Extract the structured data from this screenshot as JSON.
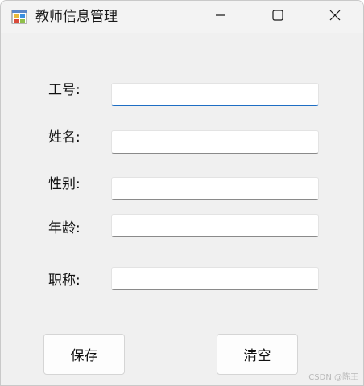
{
  "window": {
    "title": "教师信息管理",
    "icons": {
      "app": "app-form-icon",
      "minimize": "minimize-icon",
      "maximize": "maximize-icon",
      "close": "close-icon"
    }
  },
  "form": {
    "fields": [
      {
        "label": "工号:",
        "value": "",
        "focused": true
      },
      {
        "label": "姓名:",
        "value": ""
      },
      {
        "label": "性别:",
        "value": ""
      },
      {
        "label": "年龄:",
        "value": ""
      },
      {
        "label": "职称:",
        "value": ""
      }
    ],
    "buttons": {
      "save": "保存",
      "clear": "清空"
    }
  },
  "watermark": "CSDN @陈王"
}
